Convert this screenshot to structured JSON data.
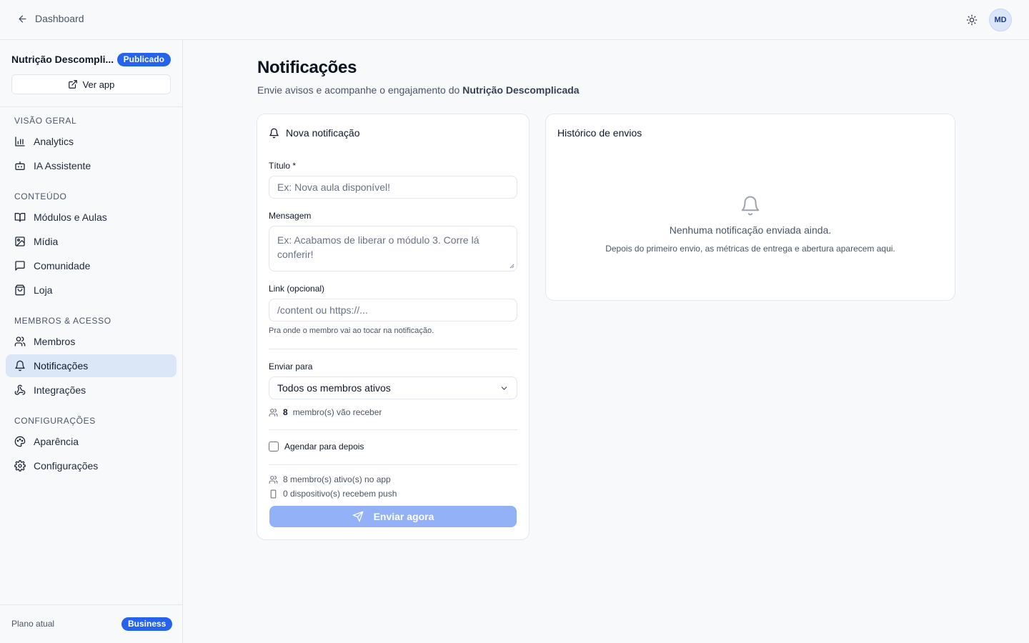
{
  "topbar": {
    "back_label": "Dashboard",
    "avatar_initials": "MD"
  },
  "sidebar": {
    "app_name": "Nutrição Descompli...",
    "status_badge": "Publicado",
    "ver_app_label": "Ver app",
    "sections": [
      {
        "label": "VISÃO GERAL",
        "items": [
          {
            "label": "Analytics",
            "icon": "bar-chart-icon"
          },
          {
            "label": "IA Assistente",
            "icon": "bot-icon"
          }
        ]
      },
      {
        "label": "CONTEÚDO",
        "items": [
          {
            "label": "Módulos e Aulas",
            "icon": "book-open-icon"
          },
          {
            "label": "Mídia",
            "icon": "image-icon"
          },
          {
            "label": "Comunidade",
            "icon": "message-square-icon"
          },
          {
            "label": "Loja",
            "icon": "shopping-bag-icon"
          }
        ]
      },
      {
        "label": "MEMBROS & ACESSO",
        "items": [
          {
            "label": "Membros",
            "icon": "users-icon"
          },
          {
            "label": "Notificações",
            "icon": "bell-icon",
            "active": true
          },
          {
            "label": "Integrações",
            "icon": "webhook-icon"
          }
        ]
      },
      {
        "label": "CONFIGURAÇÕES",
        "items": [
          {
            "label": "Aparência",
            "icon": "palette-icon"
          },
          {
            "label": "Configurações",
            "icon": "gear-icon"
          }
        ]
      }
    ],
    "plan_label": "Plano atual",
    "plan_badge": "Business"
  },
  "page": {
    "title": "Notificações",
    "subtitle_prefix": "Envie avisos e acompanhe o engajamento do ",
    "subtitle_app": "Nutrição Descomplicada"
  },
  "form": {
    "card_title": "Nova notificação",
    "title_label": "Título *",
    "title_placeholder": "Ex: Nova aula disponível!",
    "message_label": "Mensagem",
    "message_placeholder": "Ex: Acabamos de liberar o módulo 3. Corre lá conferir!",
    "link_label": "Link (opcional)",
    "link_placeholder": "/content ou https://...",
    "link_hint": "Pra onde o membro vai ao tocar na notificação.",
    "send_to_label": "Enviar para",
    "send_to_value": "Todos os membros ativos",
    "recipients_count": "8",
    "recipients_text": "membro(s) vão receber",
    "schedule_label": "Agendar para depois",
    "schedule_checked": false,
    "active_members_text": "8 membro(s) ativo(s) no app",
    "devices_text": "0 dispositivo(s) recebem push",
    "send_button": "Enviar agora"
  },
  "history": {
    "title": "Histórico de envios",
    "empty_title": "Nenhuma notificação enviada ainda.",
    "empty_sub": "Depois do primeiro envio, as métricas de entrega e abertura aparecem aqui."
  },
  "colors": {
    "accent": "#2563eb",
    "active_nav_bg": "#dbe6f7",
    "send_button_disabled": "#93b1f7"
  }
}
